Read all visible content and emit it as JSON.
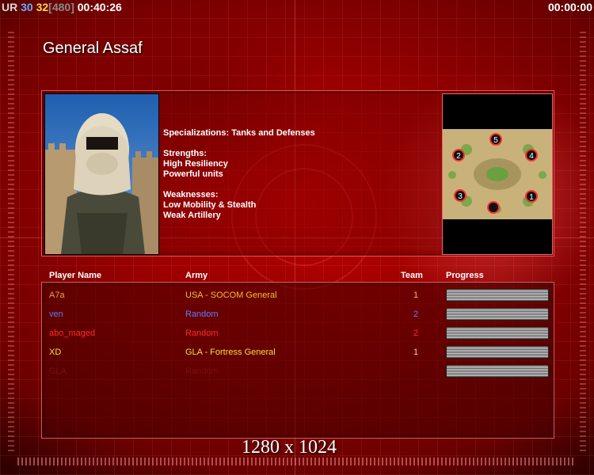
{
  "hud": {
    "prefix": "UR",
    "fps": "30",
    "frame_limit": "32",
    "frame_bracket": "[480]",
    "elapsed": "00:40:26",
    "right_timer": "00:00:00",
    "colors": {
      "prefix": "#d8d8d8",
      "fps": "#6fa8ff",
      "frame_limit": "#ffd84a",
      "bracket": "#8a8a8a"
    }
  },
  "general": {
    "name": "General Assaf",
    "specializations": "Specializations: Tanks and Defenses",
    "strengths_title": "Strengths:",
    "strengths": [
      "High Resiliency",
      "Powerful units"
    ],
    "weaknesses_title": "Weaknesses:",
    "weaknesses": [
      "Low Mobility & Stealth",
      "Weak Artillery"
    ]
  },
  "map": {
    "start_positions": [
      "5",
      "2",
      "4",
      "3",
      "1"
    ]
  },
  "players": {
    "headers": {
      "name": "Player Name",
      "army": "Army",
      "team": "Team",
      "progress": "Progress"
    },
    "rows": [
      {
        "name": "A7a",
        "army": "USA - SOCOM General",
        "team": "1",
        "color": "#f0a040",
        "army_color": "#f0c030",
        "team_color": "#f0c030"
      },
      {
        "name": "ven",
        "army": "Random",
        "team": "2",
        "color": "#5a7cff",
        "army_color": "#5a7cff",
        "team_color": "#5a7cff"
      },
      {
        "name": "abo_maged",
        "army": "Random",
        "team": "2",
        "color": "#ff2a2a",
        "army_color": "#ff2a2a",
        "team_color": "#ff2a2a"
      },
      {
        "name": "XD",
        "army": "GLA - Fortress General",
        "team": "1",
        "color": "#f0e030",
        "army_color": "#f0e030",
        "team_color": "#f0e030"
      },
      {
        "name": "GLA",
        "army": "Random",
        "team": "",
        "color": "#7a1010",
        "army_color": "#7a1010",
        "team_color": "#7a1010"
      }
    ]
  },
  "resolution": "1280 x 1024"
}
